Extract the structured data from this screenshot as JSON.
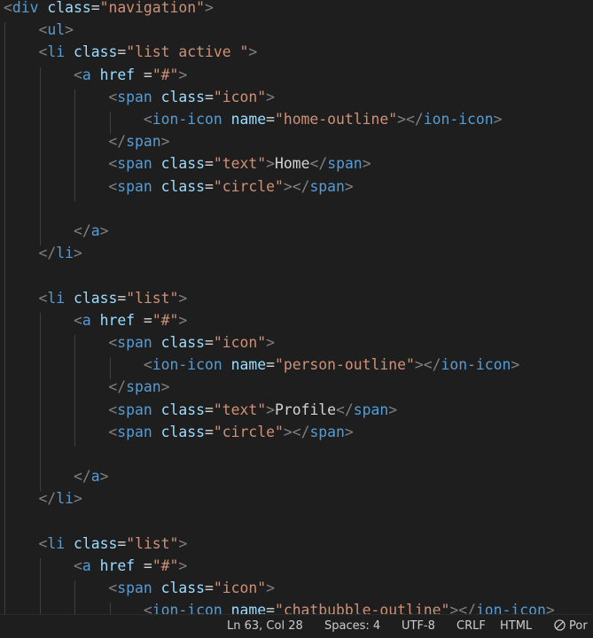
{
  "editor": {
    "lines": [
      [
        {
          "t": "<",
          "c": "punct"
        },
        {
          "t": "div",
          "c": "tag"
        },
        {
          "t": " ",
          "c": "text"
        },
        {
          "t": "class",
          "c": "attr"
        },
        {
          "t": "=",
          "c": "text"
        },
        {
          "t": "\"navigation\"",
          "c": "str"
        },
        {
          "t": ">",
          "c": "punct"
        }
      ],
      [
        {
          "t": "    ",
          "c": "text"
        },
        {
          "t": "<",
          "c": "punct"
        },
        {
          "t": "ul",
          "c": "tag"
        },
        {
          "t": ">",
          "c": "punct"
        }
      ],
      [
        {
          "t": "    ",
          "c": "text"
        },
        {
          "t": "<",
          "c": "punct"
        },
        {
          "t": "li",
          "c": "tag"
        },
        {
          "t": " ",
          "c": "text"
        },
        {
          "t": "class",
          "c": "attr"
        },
        {
          "t": "=",
          "c": "text"
        },
        {
          "t": "\"list active \"",
          "c": "str"
        },
        {
          "t": ">",
          "c": "punct"
        }
      ],
      [
        {
          "t": "        ",
          "c": "text"
        },
        {
          "t": "<",
          "c": "punct"
        },
        {
          "t": "a",
          "c": "tag"
        },
        {
          "t": " ",
          "c": "text"
        },
        {
          "t": "href",
          "c": "attr"
        },
        {
          "t": " =",
          "c": "text"
        },
        {
          "t": "\"#\"",
          "c": "str"
        },
        {
          "t": ">",
          "c": "punct"
        }
      ],
      [
        {
          "t": "            ",
          "c": "text"
        },
        {
          "t": "<",
          "c": "punct"
        },
        {
          "t": "span",
          "c": "tag"
        },
        {
          "t": " ",
          "c": "text"
        },
        {
          "t": "class",
          "c": "attr"
        },
        {
          "t": "=",
          "c": "text"
        },
        {
          "t": "\"icon\"",
          "c": "str"
        },
        {
          "t": ">",
          "c": "punct"
        }
      ],
      [
        {
          "t": "                ",
          "c": "text"
        },
        {
          "t": "<",
          "c": "punct"
        },
        {
          "t": "ion-icon",
          "c": "tag"
        },
        {
          "t": " ",
          "c": "text"
        },
        {
          "t": "name",
          "c": "attr"
        },
        {
          "t": "=",
          "c": "text"
        },
        {
          "t": "\"home-outline\"",
          "c": "str"
        },
        {
          "t": "></",
          "c": "punct"
        },
        {
          "t": "ion-icon",
          "c": "tag"
        },
        {
          "t": ">",
          "c": "punct"
        }
      ],
      [
        {
          "t": "            ",
          "c": "text"
        },
        {
          "t": "</",
          "c": "punct"
        },
        {
          "t": "span",
          "c": "tag"
        },
        {
          "t": ">",
          "c": "punct"
        }
      ],
      [
        {
          "t": "            ",
          "c": "text"
        },
        {
          "t": "<",
          "c": "punct"
        },
        {
          "t": "span",
          "c": "tag"
        },
        {
          "t": " ",
          "c": "text"
        },
        {
          "t": "class",
          "c": "attr"
        },
        {
          "t": "=",
          "c": "text"
        },
        {
          "t": "\"text\"",
          "c": "str"
        },
        {
          "t": ">",
          "c": "punct"
        },
        {
          "t": "Home",
          "c": "text"
        },
        {
          "t": "</",
          "c": "punct"
        },
        {
          "t": "span",
          "c": "tag"
        },
        {
          "t": ">",
          "c": "punct"
        }
      ],
      [
        {
          "t": "            ",
          "c": "text"
        },
        {
          "t": "<",
          "c": "punct"
        },
        {
          "t": "span",
          "c": "tag"
        },
        {
          "t": " ",
          "c": "text"
        },
        {
          "t": "class",
          "c": "attr"
        },
        {
          "t": "=",
          "c": "text"
        },
        {
          "t": "\"circle\"",
          "c": "str"
        },
        {
          "t": "></",
          "c": "punct"
        },
        {
          "t": "span",
          "c": "tag"
        },
        {
          "t": ">",
          "c": "punct"
        }
      ],
      [],
      [
        {
          "t": "        ",
          "c": "text"
        },
        {
          "t": "</",
          "c": "punct"
        },
        {
          "t": "a",
          "c": "tag"
        },
        {
          "t": ">",
          "c": "punct"
        }
      ],
      [
        {
          "t": "    ",
          "c": "text"
        },
        {
          "t": "</",
          "c": "punct"
        },
        {
          "t": "li",
          "c": "tag"
        },
        {
          "t": ">",
          "c": "punct"
        }
      ],
      [],
      [
        {
          "t": "    ",
          "c": "text"
        },
        {
          "t": "<",
          "c": "punct"
        },
        {
          "t": "li",
          "c": "tag"
        },
        {
          "t": " ",
          "c": "text"
        },
        {
          "t": "class",
          "c": "attr"
        },
        {
          "t": "=",
          "c": "text"
        },
        {
          "t": "\"list\"",
          "c": "str"
        },
        {
          "t": ">",
          "c": "punct"
        }
      ],
      [
        {
          "t": "        ",
          "c": "text"
        },
        {
          "t": "<",
          "c": "punct"
        },
        {
          "t": "a",
          "c": "tag"
        },
        {
          "t": " ",
          "c": "text"
        },
        {
          "t": "href",
          "c": "attr"
        },
        {
          "t": " =",
          "c": "text"
        },
        {
          "t": "\"#\"",
          "c": "str"
        },
        {
          "t": ">",
          "c": "punct"
        }
      ],
      [
        {
          "t": "            ",
          "c": "text"
        },
        {
          "t": "<",
          "c": "punct"
        },
        {
          "t": "span",
          "c": "tag"
        },
        {
          "t": " ",
          "c": "text"
        },
        {
          "t": "class",
          "c": "attr"
        },
        {
          "t": "=",
          "c": "text"
        },
        {
          "t": "\"icon\"",
          "c": "str"
        },
        {
          "t": ">",
          "c": "punct"
        }
      ],
      [
        {
          "t": "                ",
          "c": "text"
        },
        {
          "t": "<",
          "c": "punct"
        },
        {
          "t": "ion-icon",
          "c": "tag"
        },
        {
          "t": " ",
          "c": "text"
        },
        {
          "t": "name",
          "c": "attr"
        },
        {
          "t": "=",
          "c": "text"
        },
        {
          "t": "\"person-outline\"",
          "c": "str"
        },
        {
          "t": "></",
          "c": "punct"
        },
        {
          "t": "ion-icon",
          "c": "tag"
        },
        {
          "t": ">",
          "c": "punct"
        }
      ],
      [
        {
          "t": "            ",
          "c": "text"
        },
        {
          "t": "</",
          "c": "punct"
        },
        {
          "t": "span",
          "c": "tag"
        },
        {
          "t": ">",
          "c": "punct"
        }
      ],
      [
        {
          "t": "            ",
          "c": "text"
        },
        {
          "t": "<",
          "c": "punct"
        },
        {
          "t": "span",
          "c": "tag"
        },
        {
          "t": " ",
          "c": "text"
        },
        {
          "t": "class",
          "c": "attr"
        },
        {
          "t": "=",
          "c": "text"
        },
        {
          "t": "\"text\"",
          "c": "str"
        },
        {
          "t": ">",
          "c": "punct"
        },
        {
          "t": "Profile",
          "c": "text"
        },
        {
          "t": "</",
          "c": "punct"
        },
        {
          "t": "span",
          "c": "tag"
        },
        {
          "t": ">",
          "c": "punct"
        }
      ],
      [
        {
          "t": "            ",
          "c": "text"
        },
        {
          "t": "<",
          "c": "punct"
        },
        {
          "t": "span",
          "c": "tag"
        },
        {
          "t": " ",
          "c": "text"
        },
        {
          "t": "class",
          "c": "attr"
        },
        {
          "t": "=",
          "c": "text"
        },
        {
          "t": "\"circle\"",
          "c": "str"
        },
        {
          "t": "></",
          "c": "punct"
        },
        {
          "t": "span",
          "c": "tag"
        },
        {
          "t": ">",
          "c": "punct"
        }
      ],
      [],
      [
        {
          "t": "        ",
          "c": "text"
        },
        {
          "t": "</",
          "c": "punct"
        },
        {
          "t": "a",
          "c": "tag"
        },
        {
          "t": ">",
          "c": "punct"
        }
      ],
      [
        {
          "t": "    ",
          "c": "text"
        },
        {
          "t": "</",
          "c": "punct"
        },
        {
          "t": "li",
          "c": "tag"
        },
        {
          "t": ">",
          "c": "punct"
        }
      ],
      [],
      [
        {
          "t": "    ",
          "c": "text"
        },
        {
          "t": "<",
          "c": "punct"
        },
        {
          "t": "li",
          "c": "tag"
        },
        {
          "t": " ",
          "c": "text"
        },
        {
          "t": "class",
          "c": "attr"
        },
        {
          "t": "=",
          "c": "text"
        },
        {
          "t": "\"list\"",
          "c": "str"
        },
        {
          "t": ">",
          "c": "punct"
        }
      ],
      [
        {
          "t": "        ",
          "c": "text"
        },
        {
          "t": "<",
          "c": "punct"
        },
        {
          "t": "a",
          "c": "tag"
        },
        {
          "t": " ",
          "c": "text"
        },
        {
          "t": "href",
          "c": "attr"
        },
        {
          "t": " =",
          "c": "text"
        },
        {
          "t": "\"#\"",
          "c": "str"
        },
        {
          "t": ">",
          "c": "punct"
        }
      ],
      [
        {
          "t": "            ",
          "c": "text"
        },
        {
          "t": "<",
          "c": "punct"
        },
        {
          "t": "span",
          "c": "tag"
        },
        {
          "t": " ",
          "c": "text"
        },
        {
          "t": "class",
          "c": "attr"
        },
        {
          "t": "=",
          "c": "text"
        },
        {
          "t": "\"icon\"",
          "c": "str"
        },
        {
          "t": ">",
          "c": "punct"
        }
      ],
      [
        {
          "t": "                ",
          "c": "text"
        },
        {
          "t": "<",
          "c": "punct"
        },
        {
          "t": "ion-icon",
          "c": "tag"
        },
        {
          "t": " ",
          "c": "text"
        },
        {
          "t": "name",
          "c": "attr"
        },
        {
          "t": "=",
          "c": "text"
        },
        {
          "t": "\"chatbubble-outline\"",
          "c": "str"
        },
        {
          "t": "></",
          "c": "punct"
        },
        {
          "t": "ion-icon",
          "c": "tag"
        },
        {
          "t": ">",
          "c": "punct"
        }
      ]
    ]
  },
  "status_bar": {
    "position": "Ln 63, Col 28",
    "spaces": "Spaces: 4",
    "encoding": "UTF-8",
    "eol": "CRLF",
    "language": "HTML",
    "port": "Por",
    "port_icon": "no-entry-icon"
  },
  "colors": {
    "background": "#1e1e1e",
    "tag": "#569cd6",
    "attribute": "#9cdcfe",
    "string": "#ce9178",
    "punctuation": "#808080",
    "text": "#d4d4d4"
  }
}
